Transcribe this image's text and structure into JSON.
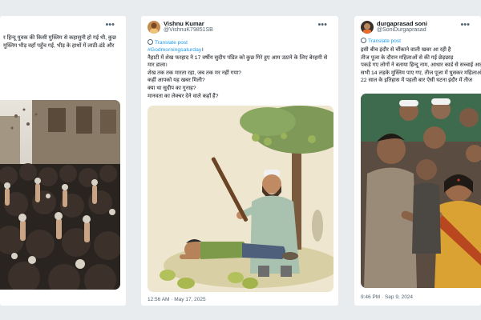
{
  "posts": [
    {
      "text_lines": [
        "र हिन्दू युवक की किसी मुस्लिम से कहासुनी हो गई थी, कुछ",
        "मुस्लिम भीड़ वहाँ पहुँच गई, भीड़ के हाथों में लाठी-डंडे और"
      ],
      "more_icon": "more-dots-icon",
      "image_subject": "crowd-with-rocks"
    },
    {
      "display_name": "Vishnu Kumar",
      "handle": "@VishnuK79851SB",
      "translate_label": "Translate post",
      "hashtag": "#Godmorningsaturday",
      "text_lines": [
        "नैहाटी में शेख फरहाद ने 17 वर्षीय सुदीप पंडित को कुछ गिरे हुए आम उठाने के लिए बेरहमी से",
        "मार डाला।",
        "शेख तक तक मारता रहा, जब तक मर नहीं गया?",
        "कहीं आपको यह खबर मिली?",
        "क्या था सुदीप का गुनाह?",
        "मानवता का लेक्चर देने वाले कहाँ हैं?"
      ],
      "timestamp": "12:56 AM · May 17, 2025",
      "more_icon": "more-dots-icon",
      "image_subject": "man-with-stick-and-boy"
    },
    {
      "display_name": "durgaprasad soni",
      "handle": "@SoniDurgaprasad",
      "translate_label": "Translate post",
      "text_lines": [
        "इसी बीच इंदौर से चौंकाने वाली खबर आ रही है",
        "तीज पूजा के दौरान महिलाओं से की गई छेड़छाड़",
        "पकड़े गए लोगों ने बताया हिन्दू नाम, आधार कार्ड से सच्चाई आई",
        "सभी 14 लड़के मुस्लिम पाए गए, तीज पूजा में घुसकर महिलाओं",
        "22 साल के इतिहास में पहली बार ऐसी घटना इंदौर में तीज"
      ],
      "timestamp": "9:46 PM · Sep 9, 2024",
      "more_icon": "more-dots-icon",
      "image_subject": "crowd-with-woman"
    }
  ]
}
